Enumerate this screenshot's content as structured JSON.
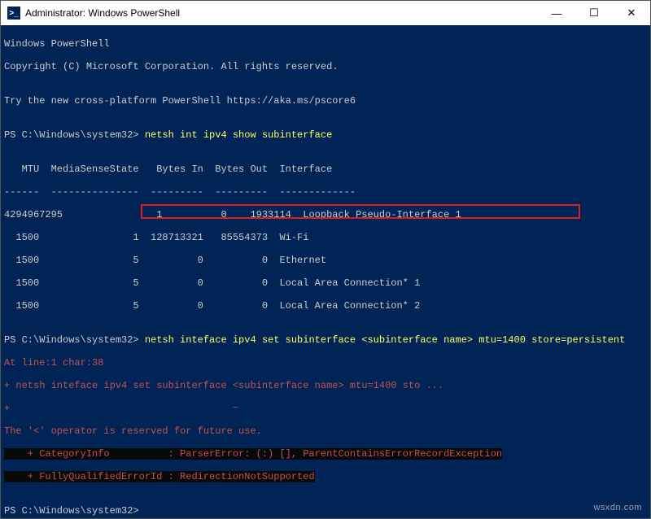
{
  "titlebar": {
    "icon_label": ">_",
    "title": "Administrator: Windows PowerShell",
    "min": "—",
    "max": "☐",
    "close": "✕"
  },
  "term": {
    "l1": "Windows PowerShell",
    "l2": "Copyright (C) Microsoft Corporation. All rights reserved.",
    "l3": "",
    "l4": "Try the new cross-platform PowerShell https://aka.ms/pscore6",
    "l5": "",
    "p1prompt": "PS C:\\Windows\\system32> ",
    "p1cmd": "netsh int ipv4 show subinterface",
    "l7": "",
    "header": "   MTU  MediaSenseState   Bytes In  Bytes Out  Interface",
    "divider": "------  ---------------  ---------  ---------  -------------",
    "r1": "4294967295                1          0    1933114  Loopback Pseudo-Interface 1",
    "r2": "  1500                1  128713321   85554373  Wi-Fi",
    "r3": "  1500                5          0          0  Ethernet",
    "r4": "  1500                5          0          0  Local Area Connection* 1",
    "r5": "  1500                5          0          0  Local Area Connection* 2",
    "l14": "",
    "p2prompt": "PS C:\\Windows\\system32> ",
    "p2cmd": "netsh inteface ipv4 set subinterface <subinterface name> mtu=1400 store=persistent",
    "e1": "At line:1 char:38",
    "e2": "+ netsh inteface ipv4 set subinterface <subinterface name> mtu=1400 sto ...",
    "e3": "+                                      ~",
    "e4": "The '<' operator is reserved for future use.",
    "e5": "    + CategoryInfo          : ParserError: (:) [], ParentContainsErrorRecordException",
    "e6": "    + FullyQualifiedErrorId : RedirectionNotSupported",
    "l22": "",
    "p3prompt": "PS C:\\Windows\\system32> "
  },
  "watermark": "wsxdn.com"
}
